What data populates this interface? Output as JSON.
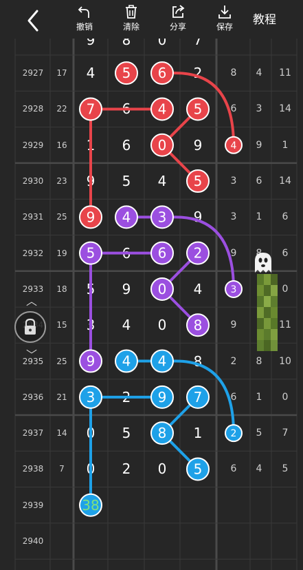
{
  "header": {
    "back_icon": "chevron-left-icon",
    "tools": [
      {
        "icon": "undo-icon",
        "label": "撤销"
      },
      {
        "icon": "trash-icon",
        "label": "清除"
      },
      {
        "icon": "share-icon",
        "label": "分享"
      },
      {
        "icon": "download-icon",
        "label": "保存"
      }
    ],
    "tutorial_label": "教程"
  },
  "colors": {
    "background": "#262626",
    "grid_line": "#3a3a3a",
    "separator": "#4a4a4a",
    "red": "#e8444a",
    "purple": "#9b4fe0",
    "blue": "#1ea1e8",
    "sum_highlight_text": "#7fe07f"
  },
  "partial_top_row": [
    "9",
    "8",
    "0",
    "7",
    "",
    "",
    ""
  ],
  "rows": [
    {
      "period": "2927",
      "sum": "17",
      "digits": [
        "4",
        "5",
        "6",
        "2"
      ],
      "right": [
        "8",
        "4",
        "11"
      ]
    },
    {
      "period": "2928",
      "sum": "22",
      "digits": [
        "7",
        "6",
        "4",
        "5"
      ],
      "right": [
        "6",
        "3",
        "14"
      ]
    },
    {
      "period": "2929",
      "sum": "16",
      "digits": [
        "1",
        "6",
        "0",
        "9"
      ],
      "right": [
        "4",
        "9",
        "1"
      ]
    },
    {
      "period": "2930",
      "sum": "23",
      "digits": [
        "9",
        "5",
        "4",
        "5"
      ],
      "right": [
        "3",
        "6",
        "14"
      ]
    },
    {
      "period": "2931",
      "sum": "25",
      "digits": [
        "9",
        "4",
        "3",
        "9"
      ],
      "right": [
        "3",
        "1",
        "6"
      ]
    },
    {
      "period": "2932",
      "sum": "19",
      "digits": [
        "5",
        "6",
        "6",
        "2"
      ],
      "right": [
        "9",
        "8",
        "6"
      ]
    },
    {
      "period": "2933",
      "sum": "18",
      "digits": [
        "5",
        "9",
        "0",
        "4"
      ],
      "right": [
        "3",
        "",
        "0"
      ]
    },
    {
      "period": "2934",
      "sum": "15",
      "digits": [
        "3",
        "4",
        "0",
        "8"
      ],
      "right": [
        "9",
        "",
        "11"
      ]
    },
    {
      "period": "2935",
      "sum": "25",
      "digits": [
        "9",
        "4",
        "4",
        "8"
      ],
      "right": [
        "2",
        "8",
        "10"
      ]
    },
    {
      "period": "2936",
      "sum": "21",
      "digits": [
        "3",
        "2",
        "9",
        "7"
      ],
      "right": [
        "6",
        "1",
        "0"
      ]
    },
    {
      "period": "2937",
      "sum": "14",
      "digits": [
        "0",
        "5",
        "8",
        "1"
      ],
      "right": [
        "2",
        "5",
        "7"
      ]
    },
    {
      "period": "2938",
      "sum": "7",
      "digits": [
        "0",
        "2",
        "0",
        "5"
      ],
      "right": [
        "6",
        "4",
        "5"
      ]
    },
    {
      "period": "2939",
      "sum": "",
      "digits": [
        "38",
        "",
        "",
        ""
      ],
      "right": [
        "",
        "",
        ""
      ]
    },
    {
      "period": "2940",
      "sum": "",
      "digits": [
        "",
        "",
        "",
        ""
      ],
      "right": [
        "",
        "",
        ""
      ]
    }
  ],
  "annotations": {
    "red": {
      "circles": [
        [
          0,
          1
        ],
        [
          0,
          2
        ],
        [
          1,
          0
        ],
        [
          1,
          2
        ],
        [
          1,
          3
        ],
        [
          2,
          2
        ],
        [
          2,
          4
        ],
        [
          3,
          3
        ],
        [
          4,
          0
        ]
      ],
      "paths": [
        [
          [
            1,
            0
          ],
          [
            1,
            2
          ]
        ],
        [
          [
            1,
            0
          ],
          [
            4,
            0
          ]
        ],
        [
          [
            0,
            2
          ],
          [
            2,
            4
          ]
        ],
        [
          [
            1,
            3
          ],
          [
            2,
            2
          ],
          [
            3,
            3
          ]
        ]
      ]
    },
    "purple": {
      "circles": [
        [
          4,
          1
        ],
        [
          4,
          2
        ],
        [
          5,
          0
        ],
        [
          5,
          2
        ],
        [
          5,
          3
        ],
        [
          6,
          2
        ],
        [
          6,
          4
        ],
        [
          7,
          3
        ],
        [
          8,
          0
        ]
      ],
      "paths": [
        [
          [
            4,
            1
          ],
          [
            4,
            2
          ]
        ],
        [
          [
            4,
            2
          ],
          [
            6,
            4
          ]
        ],
        [
          [
            5,
            0
          ],
          [
            5,
            2
          ]
        ],
        [
          [
            5,
            0
          ],
          [
            8,
            0
          ]
        ],
        [
          [
            5,
            3
          ],
          [
            6,
            2
          ],
          [
            7,
            3
          ]
        ]
      ]
    },
    "blue": {
      "circles": [
        [
          8,
          1
        ],
        [
          8,
          2
        ],
        [
          9,
          0
        ],
        [
          9,
          2
        ],
        [
          9,
          3
        ],
        [
          10,
          2
        ],
        [
          10,
          4
        ],
        [
          11,
          3
        ],
        [
          12,
          0
        ]
      ],
      "paths": [
        [
          [
            8,
            1
          ],
          [
            8,
            2
          ]
        ],
        [
          [
            8,
            2
          ],
          [
            10,
            4
          ]
        ],
        [
          [
            9,
            0
          ],
          [
            9,
            2
          ]
        ],
        [
          [
            9,
            0
          ],
          [
            12,
            0
          ]
        ],
        [
          [
            9,
            3
          ],
          [
            10,
            2
          ],
          [
            11,
            3
          ]
        ]
      ]
    }
  },
  "overlay_controls": {
    "lock_icon": "lock-icon",
    "scroll_up_icon": "chevron-up-icon",
    "scroll_down_icon": "chevron-down-icon",
    "ghost_icon": "ghost-emoji-icon"
  }
}
